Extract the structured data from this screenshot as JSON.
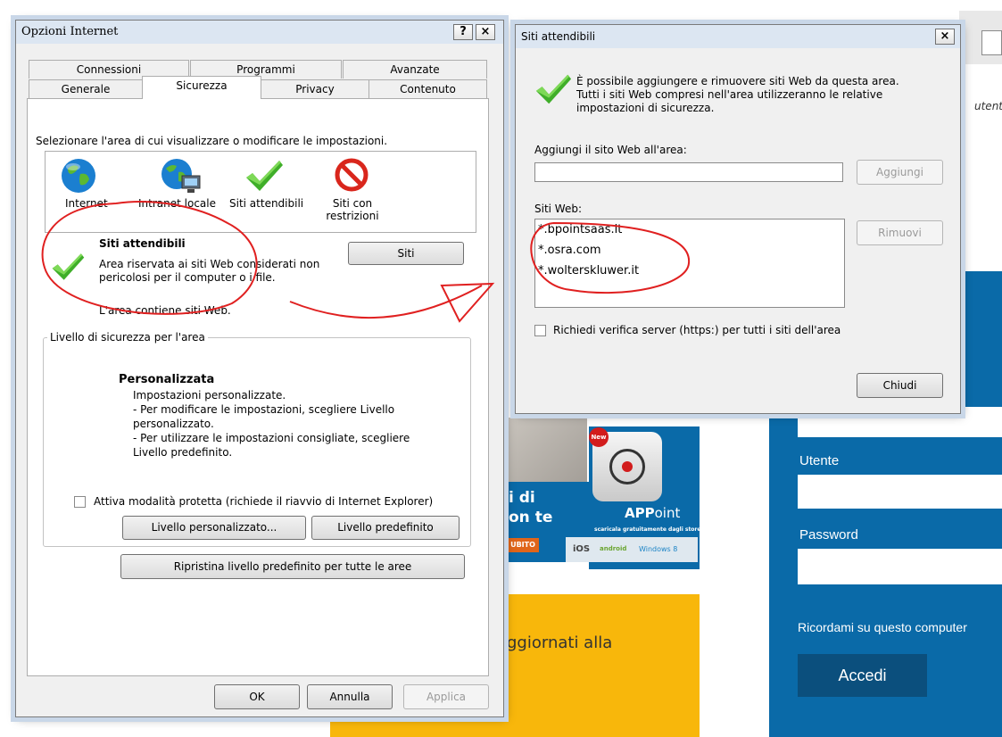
{
  "main_dialog": {
    "title": "Opzioni Internet",
    "help_btn": "?",
    "close_btn": "×",
    "tabs_row1": [
      "Connessioni",
      "Programmi",
      "Avanzate"
    ],
    "tabs_row2": [
      "Generale",
      "Sicurezza",
      "Privacy",
      "Contenuto"
    ],
    "zone_prompt": "Selezionare l'area di cui visualizzare o modificare le impostazioni.",
    "zones": [
      "Internet",
      "Intranet locale",
      "Siti attendibili",
      "Siti con restrizioni"
    ],
    "zone_title": "Siti attendibili",
    "zone_desc": "Area riservata ai siti Web considerati non pericolosi per il computer o i file.",
    "zone_contains": "L'area contiene siti Web.",
    "sites_btn": "Siti",
    "level_group": "Livello di sicurezza per l'area",
    "level_name": "Personalizzata",
    "level_lines": [
      "Impostazioni personalizzate.",
      "- Per modificare le impostazioni, scegliere Livello",
      "personalizzato.",
      "- Per utilizzare le impostazioni consigliate, scegliere",
      "Livello predefinito."
    ],
    "protected_mode": "Attiva modalità protetta (richiede il riavvio di Internet Explorer)",
    "custom_level_btn": "Livello personalizzato...",
    "default_level_btn": "Livello predefinito",
    "reset_all_btn": "Ripristina livello predefinito per tutte le aree",
    "ok_btn": "OK",
    "cancel_btn": "Annulla",
    "apply_btn": "Applica"
  },
  "trusted_dialog": {
    "title": "Siti attendibili",
    "close_btn": "×",
    "info_lines": [
      "È possibile aggiungere e rimuovere siti Web da questa area.",
      "Tutti i siti Web compresi nell'area utilizzeranno le relative",
      "impostazioni di sicurezza."
    ],
    "add_label": "Aggiungi il sito Web all'area:",
    "add_value": "",
    "add_btn": "Aggiungi",
    "sites_label": "Siti Web:",
    "sites": [
      "*.bpointsaas.it",
      "*.osra.com",
      "*.wolterskluwer.it"
    ],
    "remove_btn": "Rimuovi",
    "https_check": "Richiedi verifica server (https:) per tutti i siti dell'area",
    "close_action": "Chiudi"
  },
  "background": {
    "top_right_text": "utent",
    "promo_line1": "i di",
    "promo_line2": "on te",
    "promo_btn": "UBITO",
    "promo_bottom": "ggiornati alla",
    "app_badge": "New",
    "app_name_bold": "APP",
    "app_name": "oint",
    "app_store_text": "scaricala gratuitamente dagli store",
    "app_platforms": [
      "iOS",
      "android",
      "Windows 8"
    ],
    "login_user_label": "Utente",
    "login_password_label": "Password",
    "login_remember": "Ricordami su questo computer",
    "login_button": "Accedi",
    "colors": {
      "blue": "#0a6aa8",
      "yellow": "#f8b70b",
      "dark_btn": "#0b4f7d"
    }
  }
}
